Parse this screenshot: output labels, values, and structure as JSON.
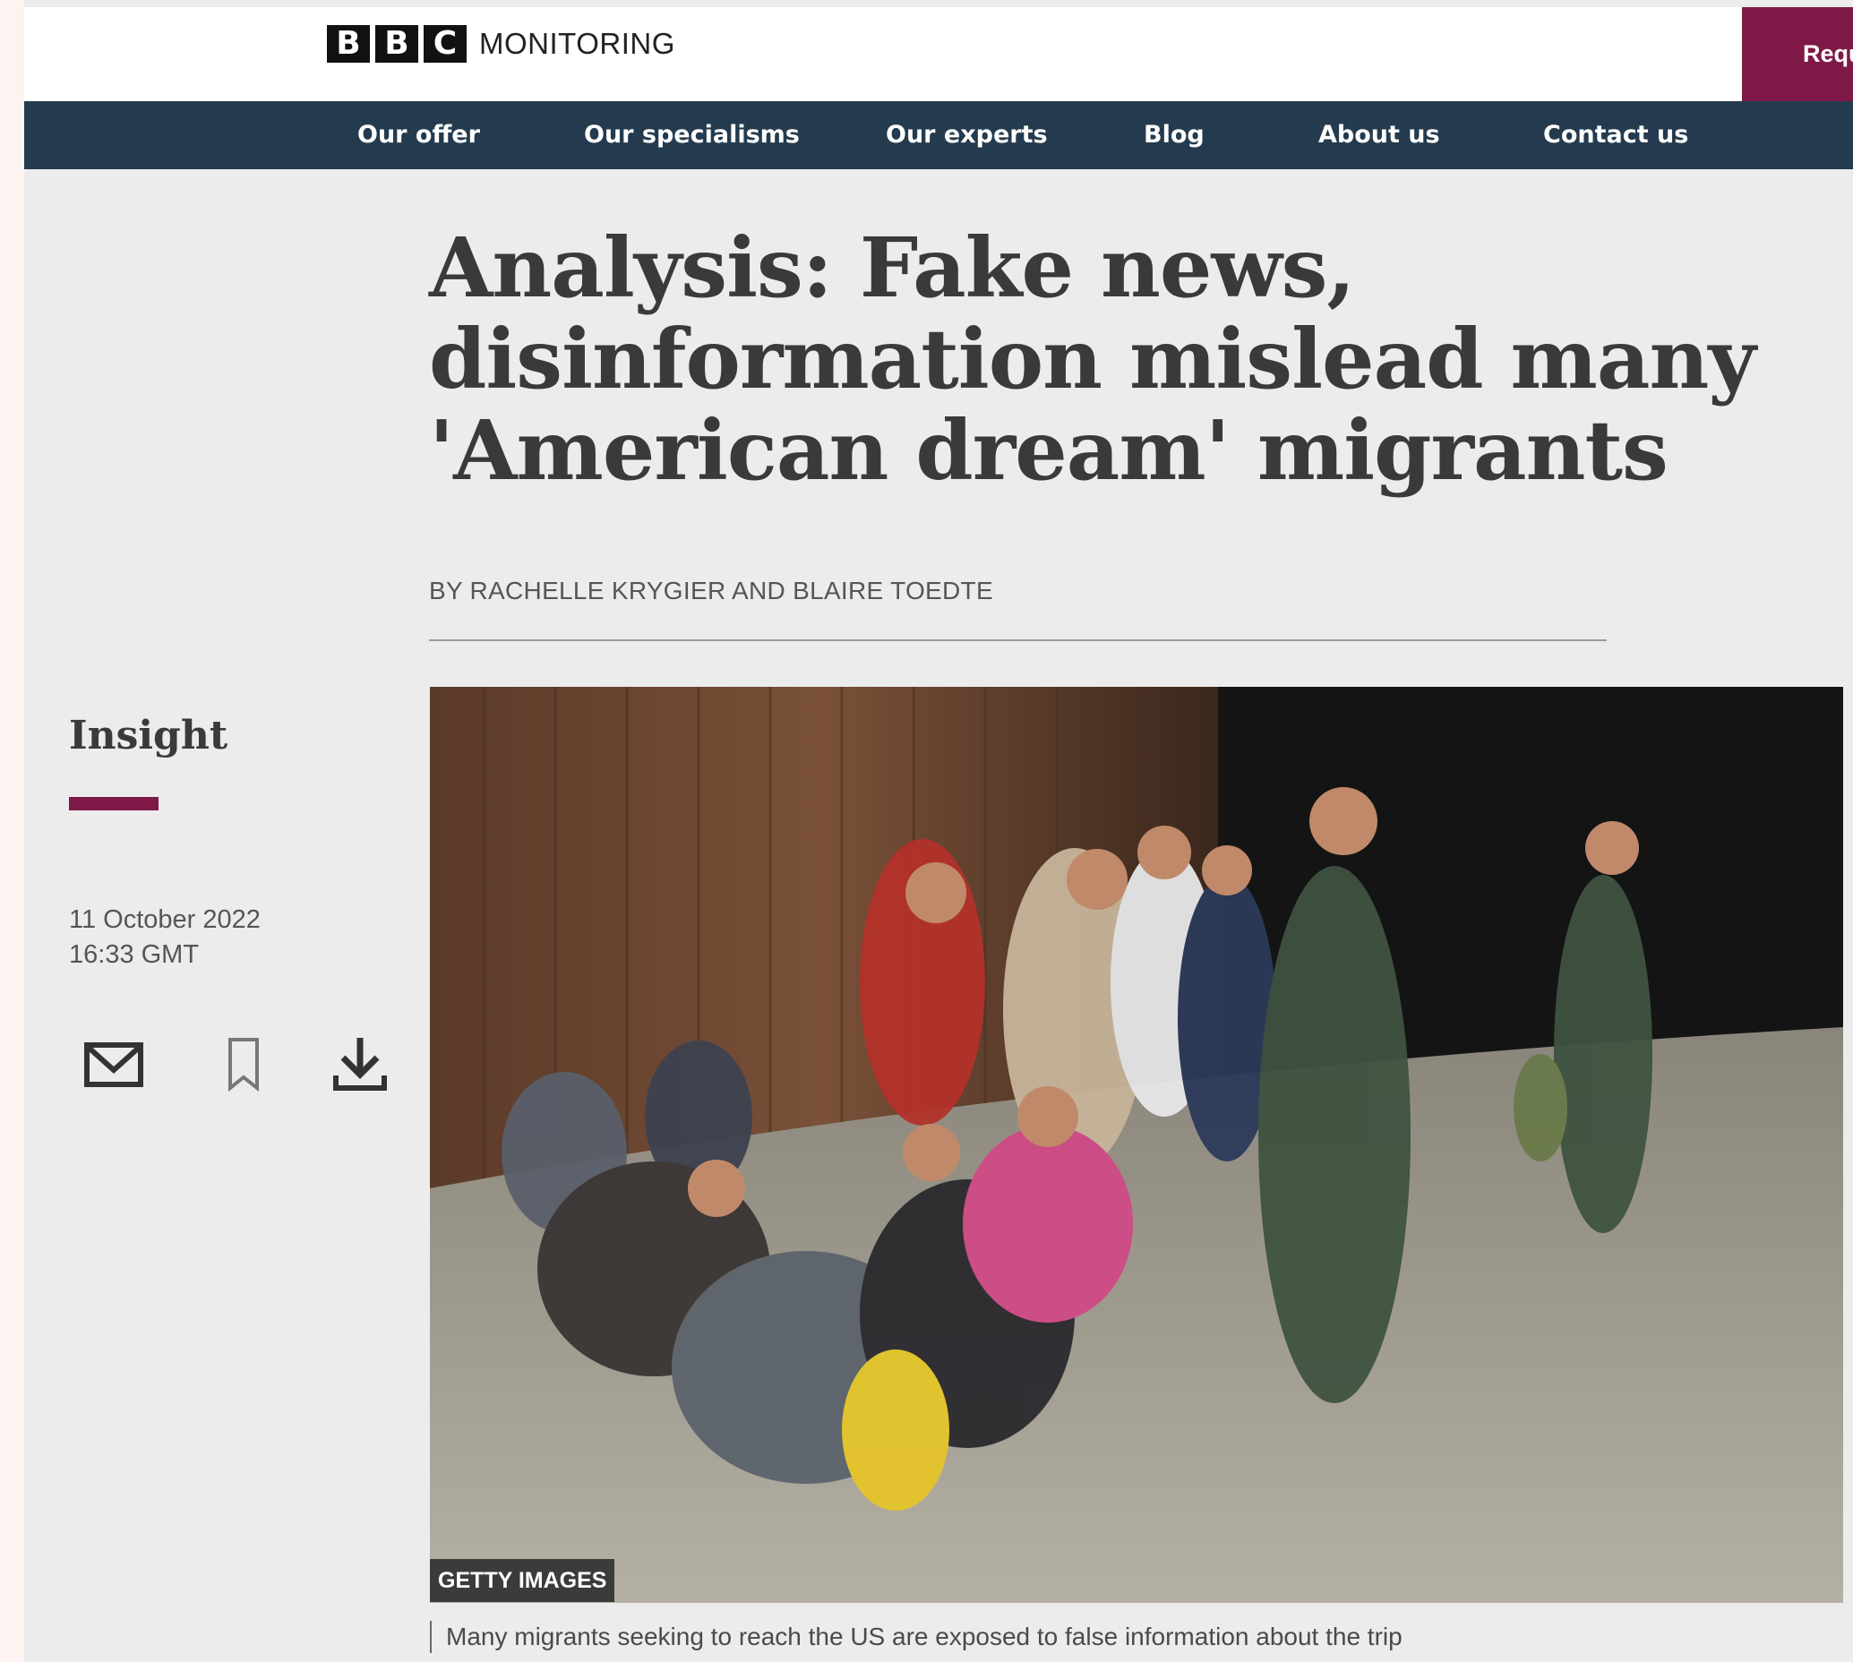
{
  "header": {
    "logo_letters": [
      "B",
      "B",
      "C"
    ],
    "logo_text": "MONITORING",
    "request_label": "Requ"
  },
  "nav": {
    "items": [
      "Our offer",
      "Our specialisms",
      "Our experts",
      "Blog",
      "About us",
      "Contact us"
    ]
  },
  "article": {
    "headline": "Analysis: Fake news, disinformation mislead many 'American dream' migrants",
    "byline": "BY RACHELLE KRYGIER AND BLAIRE TOEDTE",
    "category": "Insight",
    "date": "11 October 2022",
    "time": "16:33 GMT",
    "actions": [
      "envelope-icon",
      "bookmark-icon",
      "download-icon"
    ]
  },
  "image": {
    "credit": "GETTY IMAGES",
    "caption": "Many migrants seeking to reach the US are exposed to false information about the trip"
  },
  "colors": {
    "accent": "#7e1947",
    "nav_bg": "#243b4f",
    "page_bg": "#ececec"
  }
}
